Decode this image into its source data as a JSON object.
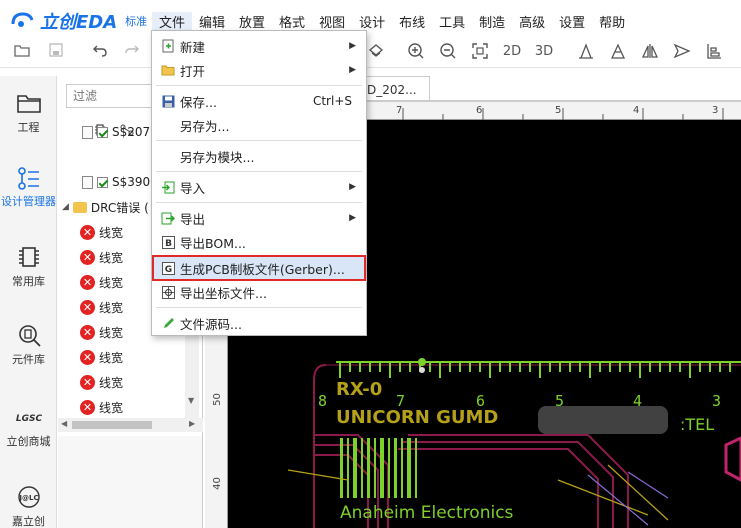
{
  "app": {
    "logo_text": "立创EDA",
    "logo_sub": "标准"
  },
  "menubar": {
    "items": [
      "文件",
      "编辑",
      "放置",
      "格式",
      "视图",
      "设计",
      "布线",
      "工具",
      "制造",
      "高级",
      "设置",
      "帮助"
    ]
  },
  "toolbar": {
    "labels": [
      "2D",
      "3D"
    ]
  },
  "leftnav": {
    "items": [
      "工程",
      "设计管理器",
      "常用库",
      "元件库",
      "立创商城",
      "嘉立创"
    ]
  },
  "panel": {
    "filter_placeholder": "过滤",
    "tree": [
      {
        "type": "file",
        "label": "S$2072"
      },
      {
        "type": "file",
        "label": "S$3900"
      },
      {
        "type": "folder",
        "label": "DRC错误 ("
      },
      {
        "type": "error",
        "label": "线宽"
      },
      {
        "type": "error",
        "label": "线宽"
      },
      {
        "type": "error",
        "label": "线宽"
      },
      {
        "type": "error",
        "label": "线宽"
      },
      {
        "type": "error",
        "label": "线宽"
      },
      {
        "type": "error",
        "label": "线宽"
      },
      {
        "type": "error",
        "label": "线宽"
      },
      {
        "type": "error",
        "label": "线宽"
      }
    ]
  },
  "doc_tab": {
    "label": "D_202..."
  },
  "file_menu": {
    "items": [
      {
        "label": "新建",
        "icon": "new-file-icon",
        "submenu": true
      },
      {
        "label": "打开",
        "icon": "folder-open-icon",
        "submenu": true
      },
      {
        "label": "保存...",
        "icon": "save-icon",
        "shortcut": "Ctrl+S"
      },
      {
        "label": "另存为...",
        "icon": ""
      },
      {
        "label": "另存为模块...",
        "icon": ""
      },
      {
        "label": "导入",
        "icon": "import-icon",
        "submenu": true
      },
      {
        "label": "导出",
        "icon": "export-icon",
        "submenu": true
      },
      {
        "label": "导出BOM...",
        "icon": "bom-icon"
      },
      {
        "label": "生成PCB制板文件(Gerber)...",
        "icon": "gerber-icon"
      },
      {
        "label": "导出坐标文件...",
        "icon": "coordinate-icon"
      },
      {
        "label": "文件源码...",
        "icon": "pencil-icon"
      }
    ]
  },
  "rulers": {
    "top": [
      "8",
      "7",
      "6",
      "5",
      "4",
      "3"
    ],
    "left": [
      "50",
      "40"
    ]
  },
  "pcb": {
    "silk_line1": "RX-0",
    "silk_line2": "UNICORN GUMD",
    "tel": ":TEL",
    "bottom_text": "Anaheim Electronics",
    "scale_digits": [
      "8",
      "7",
      "6",
      "5",
      "4",
      "3"
    ]
  },
  "colors": {
    "accent": "#1a73e8",
    "highlight_outline": "#e02a2a",
    "pcb_green": "#7cd12b",
    "pcb_gold": "#b5a019",
    "pcb_trace": "#8b1a4a"
  }
}
